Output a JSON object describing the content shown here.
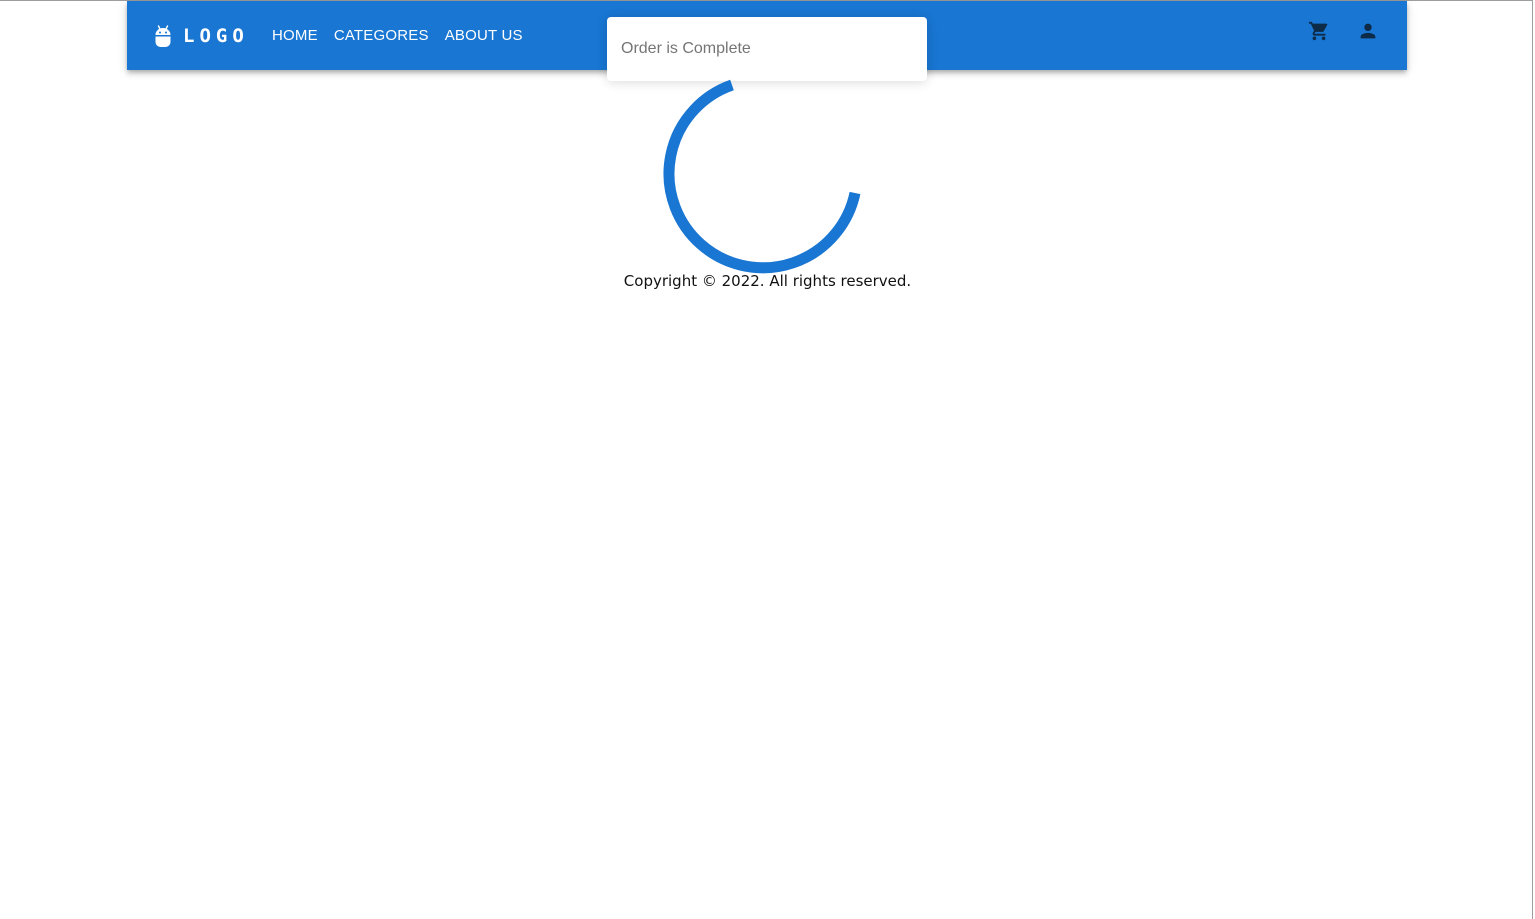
{
  "header": {
    "logo_text": "LOGO",
    "logo_icon": "android-icon",
    "nav_items": [
      {
        "label": "HOME"
      },
      {
        "label": "CATEGORES"
      },
      {
        "label": "ABOUT US"
      }
    ],
    "cart_icon": "shopping-cart-icon",
    "account_icon": "person-icon"
  },
  "toast": {
    "message": "Order is Complete"
  },
  "loader": {
    "icon": "circular-progress-spinner",
    "color": "#1976d2"
  },
  "footer": {
    "copyright": "Copyright © 2022. All rights reserved."
  },
  "colors": {
    "primary": "#1976d2",
    "toast_text": "#757575"
  }
}
